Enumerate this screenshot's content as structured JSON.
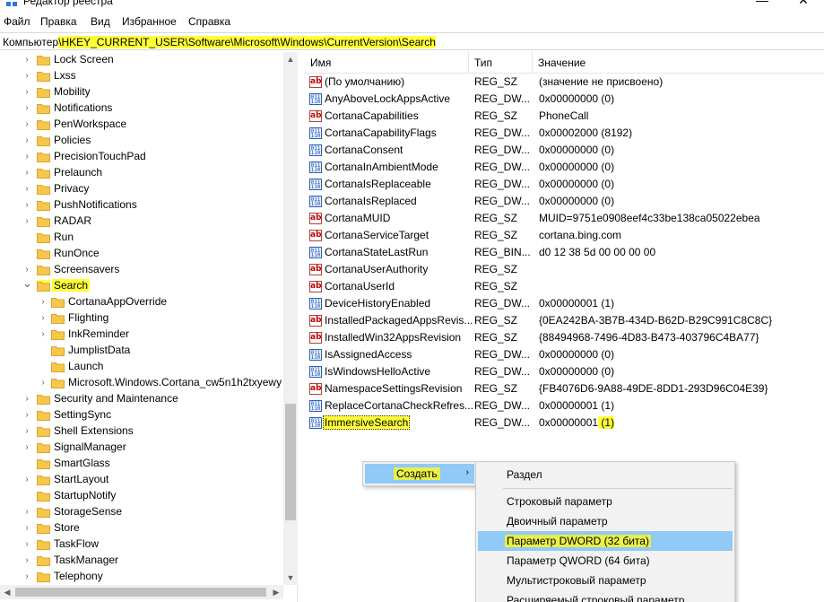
{
  "window": {
    "title": "Редактор реестра",
    "minimize_label": "—",
    "close_label": "✕"
  },
  "menu": [
    "Файл",
    "Правка",
    "Вид",
    "Избранное",
    "Справка"
  ],
  "address": {
    "prefix": "Компьютер",
    "path": "\\HKEY_CURRENT_USER\\Software\\Microsoft\\Windows\\CurrentVersion\\Search"
  },
  "tree": {
    "items": [
      {
        "label": "Lock Screen",
        "level": 1,
        "expander": "collapsed"
      },
      {
        "label": "Lxss",
        "level": 1,
        "expander": "collapsed"
      },
      {
        "label": "Mobility",
        "level": 1,
        "expander": "collapsed"
      },
      {
        "label": "Notifications",
        "level": 1,
        "expander": "collapsed"
      },
      {
        "label": "PenWorkspace",
        "level": 1,
        "expander": "collapsed"
      },
      {
        "label": "Policies",
        "level": 1,
        "expander": "collapsed"
      },
      {
        "label": "PrecisionTouchPad",
        "level": 1,
        "expander": "collapsed"
      },
      {
        "label": "Prelaunch",
        "level": 1,
        "expander": "collapsed"
      },
      {
        "label": "Privacy",
        "level": 1,
        "expander": "collapsed"
      },
      {
        "label": "PushNotifications",
        "level": 1,
        "expander": "collapsed"
      },
      {
        "label": "RADAR",
        "level": 1,
        "expander": "collapsed"
      },
      {
        "label": "Run",
        "level": 1,
        "expander": "none"
      },
      {
        "label": "RunOnce",
        "level": 1,
        "expander": "none"
      },
      {
        "label": "Screensavers",
        "level": 1,
        "expander": "collapsed"
      },
      {
        "label": "Search",
        "level": 1,
        "expander": "expanded",
        "selected": true
      },
      {
        "label": "CortanaAppOverride",
        "level": 2,
        "expander": "collapsed"
      },
      {
        "label": "Flighting",
        "level": 2,
        "expander": "collapsed"
      },
      {
        "label": "InkReminder",
        "level": 2,
        "expander": "collapsed"
      },
      {
        "label": "JumplistData",
        "level": 2,
        "expander": "none"
      },
      {
        "label": "Launch",
        "level": 2,
        "expander": "none"
      },
      {
        "label": "Microsoft.Windows.Cortana_cw5n1h2txyewy",
        "level": 2,
        "expander": "collapsed"
      },
      {
        "label": "Security and Maintenance",
        "level": 1,
        "expander": "collapsed"
      },
      {
        "label": "SettingSync",
        "level": 1,
        "expander": "collapsed"
      },
      {
        "label": "Shell Extensions",
        "level": 1,
        "expander": "collapsed"
      },
      {
        "label": "SignalManager",
        "level": 1,
        "expander": "collapsed"
      },
      {
        "label": "SmartGlass",
        "level": 1,
        "expander": "none"
      },
      {
        "label": "StartLayout",
        "level": 1,
        "expander": "collapsed"
      },
      {
        "label": "StartupNotify",
        "level": 1,
        "expander": "none"
      },
      {
        "label": "StorageSense",
        "level": 1,
        "expander": "collapsed"
      },
      {
        "label": "Store",
        "level": 1,
        "expander": "collapsed"
      },
      {
        "label": "TaskFlow",
        "level": 1,
        "expander": "collapsed"
      },
      {
        "label": "TaskManager",
        "level": 1,
        "expander": "collapsed"
      },
      {
        "label": "Telephony",
        "level": 1,
        "expander": "collapsed"
      }
    ]
  },
  "list": {
    "columns": {
      "name": "Имя",
      "type": "Тип",
      "value": "Значение"
    },
    "rows": [
      {
        "name": "(По умолчанию)",
        "type": "REG_SZ",
        "value": "(значение не присвоено)",
        "icon": "string-value-icon"
      },
      {
        "name": "AnyAboveLockAppsActive",
        "type": "REG_DW...",
        "value": "0x00000000 (0)",
        "icon": "binary-value-icon"
      },
      {
        "name": "CortanaCapabilities",
        "type": "REG_SZ",
        "value": "PhoneCall",
        "icon": "string-value-icon"
      },
      {
        "name": "CortanaCapabilityFlags",
        "type": "REG_DW...",
        "value": "0x00002000 (8192)",
        "icon": "binary-value-icon"
      },
      {
        "name": "CortanaConsent",
        "type": "REG_DW...",
        "value": "0x00000000 (0)",
        "icon": "binary-value-icon"
      },
      {
        "name": "CortanaInAmbientMode",
        "type": "REG_DW...",
        "value": "0x00000000 (0)",
        "icon": "binary-value-icon"
      },
      {
        "name": "CortanaIsReplaceable",
        "type": "REG_DW...",
        "value": "0x00000000 (0)",
        "icon": "binary-value-icon"
      },
      {
        "name": "CortanaIsReplaced",
        "type": "REG_DW...",
        "value": "0x00000000 (0)",
        "icon": "binary-value-icon"
      },
      {
        "name": "CortanaMUID",
        "type": "REG_SZ",
        "value": "MUID=9751e0908eef4c33be138ca05022ebea",
        "icon": "string-value-icon"
      },
      {
        "name": "CortanaServiceTarget",
        "type": "REG_SZ",
        "value": "cortana.bing.com",
        "icon": "string-value-icon"
      },
      {
        "name": "CortanaStateLastRun",
        "type": "REG_BIN...",
        "value": "d0 12 38 5d 00 00 00 00",
        "icon": "binary-value-icon"
      },
      {
        "name": "CortanaUserAuthority",
        "type": "REG_SZ",
        "value": "",
        "icon": "string-value-icon"
      },
      {
        "name": "CortanaUserId",
        "type": "REG_SZ",
        "value": "",
        "icon": "string-value-icon"
      },
      {
        "name": "DeviceHistoryEnabled",
        "type": "REG_DW...",
        "value": "0x00000001 (1)",
        "icon": "binary-value-icon"
      },
      {
        "name": "InstalledPackagedAppsRevis...",
        "type": "REG_SZ",
        "value": "{0EA242BA-3B7B-434D-B62D-B29C991C8C8C}",
        "icon": "string-value-icon"
      },
      {
        "name": "InstalledWin32AppsRevision",
        "type": "REG_SZ",
        "value": "{88494968-7496-4D83-B473-403796C4BA77}",
        "icon": "string-value-icon"
      },
      {
        "name": "IsAssignedAccess",
        "type": "REG_DW...",
        "value": "0x00000000 (0)",
        "icon": "binary-value-icon"
      },
      {
        "name": "IsWindowsHelloActive",
        "type": "REG_DW...",
        "value": "0x00000000 (0)",
        "icon": "binary-value-icon"
      },
      {
        "name": "NamespaceSettingsRevision",
        "type": "REG_SZ",
        "value": "{FB4076D6-9A88-49DE-8DD1-293D96C04E39}",
        "icon": "string-value-icon"
      },
      {
        "name": "ReplaceCortanaCheckRefres...",
        "type": "REG_DW...",
        "value": "0x00000001 (1)",
        "icon": "binary-value-icon"
      },
      {
        "name": "ImmersiveSearch",
        "type": "REG_DW...",
        "value_main": "0x00000001",
        "value_hl": " (1)",
        "icon": "binary-value-icon",
        "highlighted": true
      }
    ]
  },
  "context_menu": {
    "create_label": "Создать",
    "submenu_arrow": "›",
    "submenu": [
      {
        "label": "Раздел"
      },
      {
        "label": "Строковый параметр"
      },
      {
        "label": "Двоичный параметр"
      },
      {
        "label": "Параметр DWORD (32 бита)",
        "active": true
      },
      {
        "label": "Параметр QWORD (64 бита)"
      },
      {
        "label": "Мультистроковый параметр"
      },
      {
        "label": "Расширяемый строковый параметр"
      }
    ]
  },
  "colors": {
    "highlight": "#ffff3a",
    "menu_hover": "#91c9f7",
    "folder": "#f5c74c"
  }
}
